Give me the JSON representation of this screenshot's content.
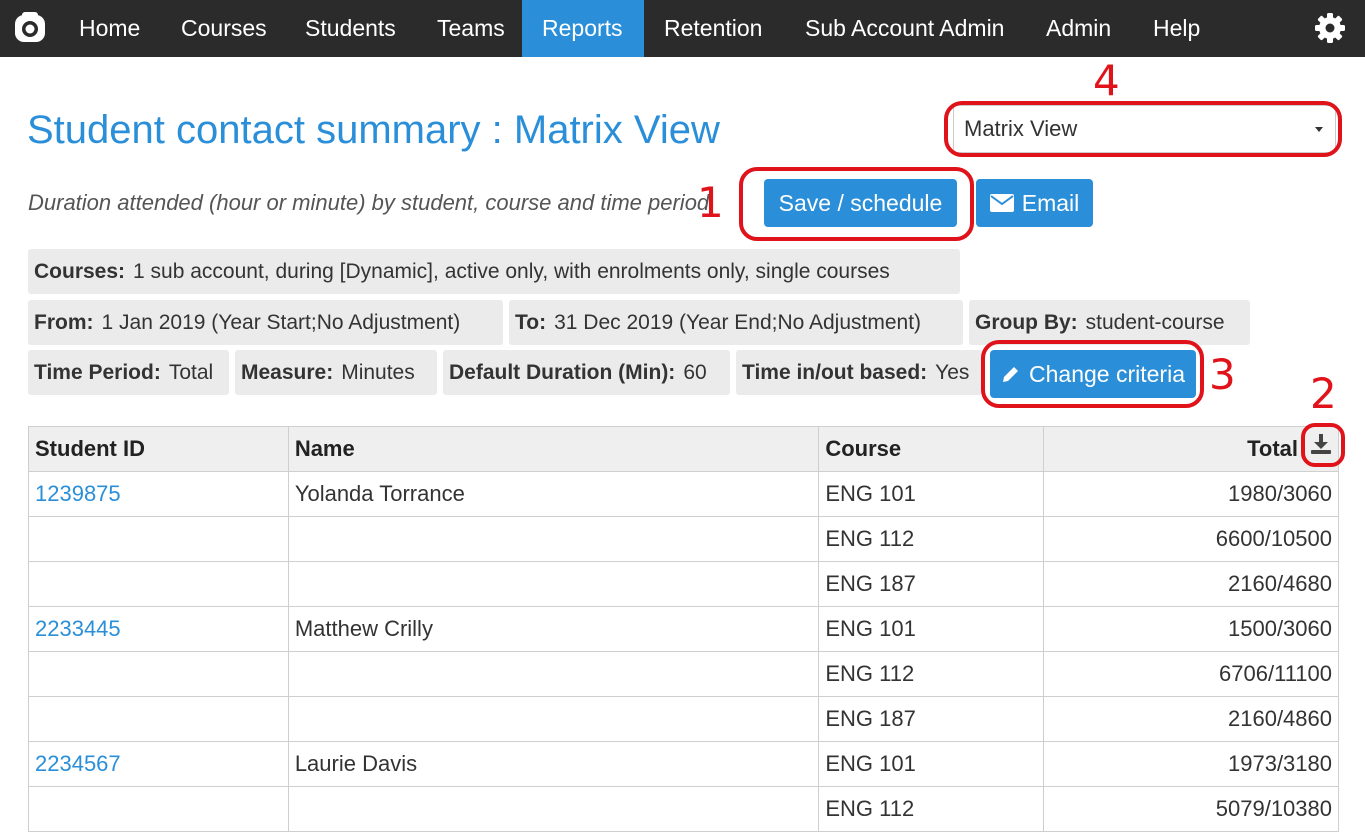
{
  "nav": {
    "items": [
      {
        "label": "Home"
      },
      {
        "label": "Courses"
      },
      {
        "label": "Students"
      },
      {
        "label": "Teams"
      },
      {
        "label": "Reports",
        "active": true
      },
      {
        "label": "Retention"
      },
      {
        "label": "Sub Account Admin"
      },
      {
        "label": "Admin"
      },
      {
        "label": "Help"
      }
    ],
    "accent_color": "#2a8fd8"
  },
  "page": {
    "title": "Student contact summary : Matrix View",
    "subtitle": "Duration attended (hour or minute) by student, course and time period"
  },
  "view_select": {
    "selected": "Matrix View"
  },
  "buttons": {
    "save": "Save / schedule",
    "email": "Email",
    "change": "Change criteria"
  },
  "criteria": {
    "courses": {
      "label": "Courses:",
      "value": "1 sub account, during [Dynamic], active only, with enrolments only, single courses"
    },
    "from": {
      "label": "From:",
      "value": "1 Jan 2019 (Year Start;No Adjustment)"
    },
    "to": {
      "label": "To:",
      "value": "31 Dec 2019 (Year End;No Adjustment)"
    },
    "group_by": {
      "label": "Group By:",
      "value": "student-course"
    },
    "time_period": {
      "label": "Time Period:",
      "value": "Total"
    },
    "measure": {
      "label": "Measure:",
      "value": "Minutes"
    },
    "default_duration": {
      "label": "Default Duration (Min):",
      "value": "60"
    },
    "time_in_out": {
      "label": "Time in/out based:",
      "value": "Yes"
    }
  },
  "table": {
    "headers": [
      "Student ID",
      "Name",
      "Course",
      "Total"
    ],
    "rows": [
      {
        "id": "1239875",
        "name": "Yolanda Torrance",
        "course": "ENG 101",
        "total": "1980/3060"
      },
      {
        "id": "",
        "name": "",
        "course": "ENG 112",
        "total": "6600/10500"
      },
      {
        "id": "",
        "name": "",
        "course": "ENG 187",
        "total": "2160/4680"
      },
      {
        "id": "2233445",
        "name": "Matthew Crilly",
        "course": "ENG 101",
        "total": "1500/3060"
      },
      {
        "id": "",
        "name": "",
        "course": "ENG 112",
        "total": "6706/11100"
      },
      {
        "id": "",
        "name": "",
        "course": "ENG 187",
        "total": "2160/4860"
      },
      {
        "id": "2234567",
        "name": "Laurie Davis",
        "course": "ENG 101",
        "total": "1973/3180"
      },
      {
        "id": "",
        "name": "",
        "course": "ENG 112",
        "total": "5079/10380"
      }
    ]
  },
  "annotations": {
    "one": "1",
    "two": "2",
    "three": "3",
    "four": "4",
    "color": "#e0121a"
  },
  "icons": {
    "logo": "app-logo-icon",
    "settings": "gear-icon",
    "email": "envelope-icon",
    "edit": "pencil-icon",
    "download": "download-icon"
  }
}
